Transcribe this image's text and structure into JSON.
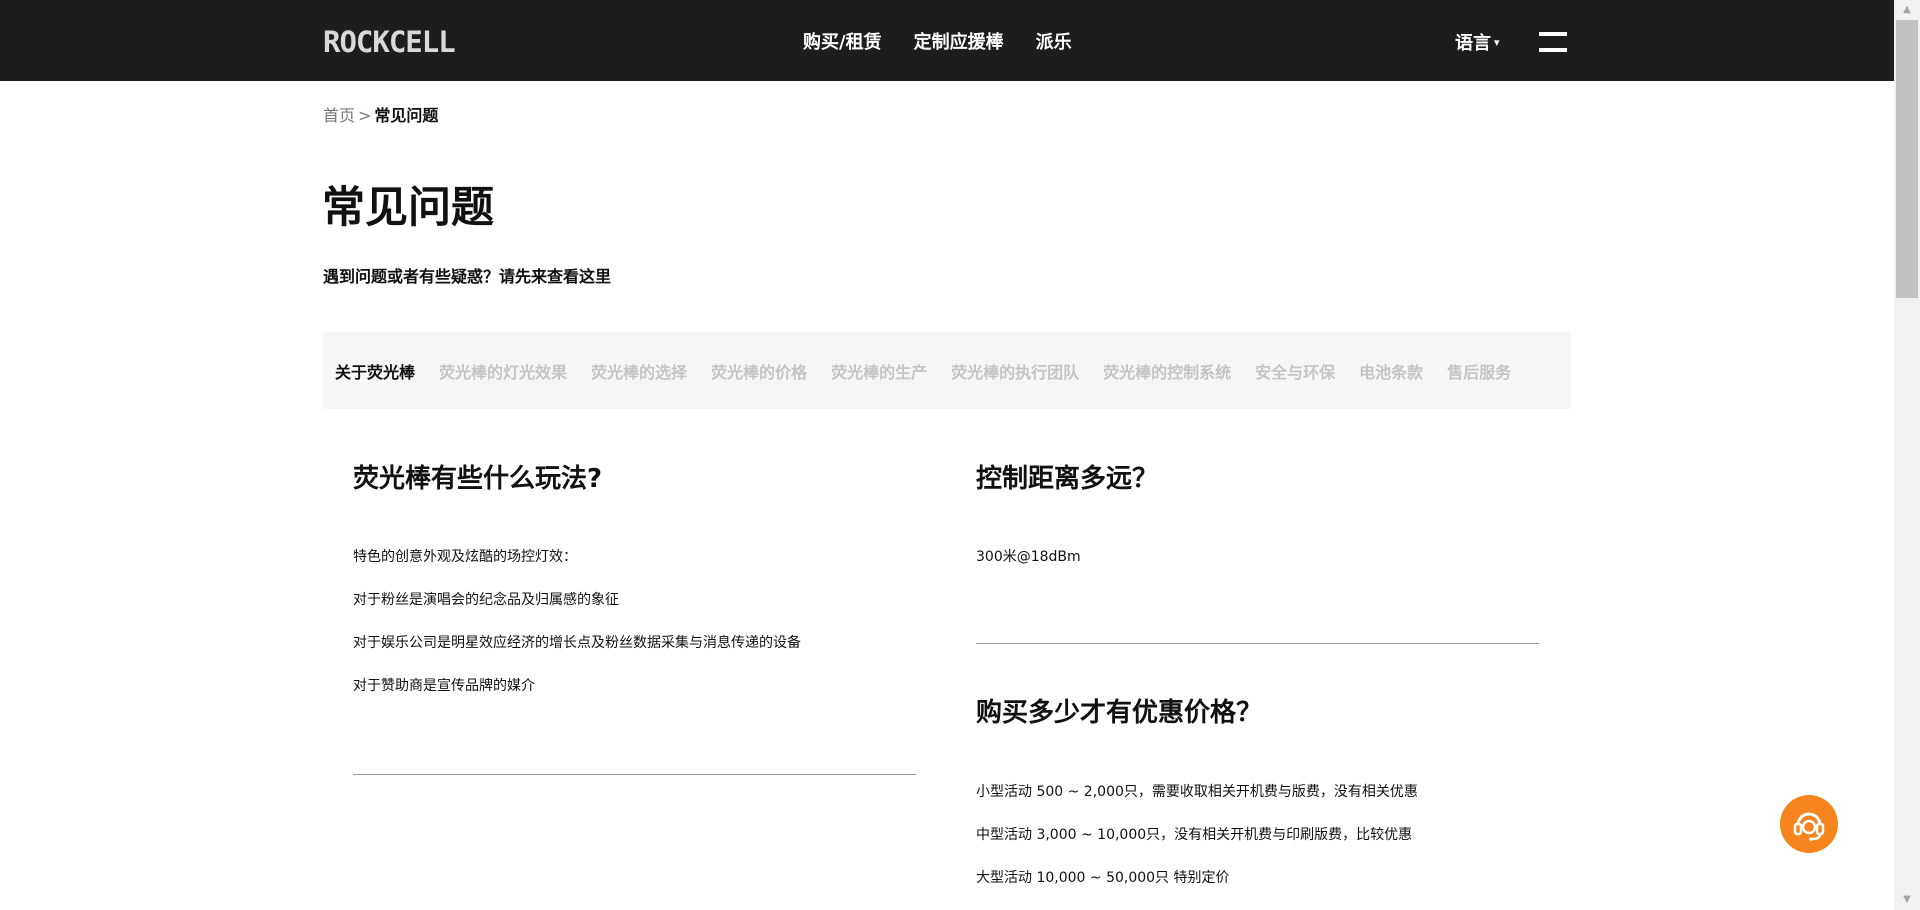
{
  "header": {
    "logo": "ROCKCELL",
    "nav": [
      "购买/租赁",
      "定制应援棒",
      "派乐"
    ],
    "language": "语言"
  },
  "breadcrumb": {
    "home": "首页",
    "separator": ">",
    "current": "常见问题"
  },
  "page": {
    "title": "常见问题",
    "subtitle": "遇到问题或者有些疑惑？请先来查看这里"
  },
  "tabs": [
    {
      "label": "关于荧光棒",
      "active": true
    },
    {
      "label": "荧光棒的灯光效果",
      "active": false
    },
    {
      "label": "荧光棒的选择",
      "active": false
    },
    {
      "label": "荧光棒的价格",
      "active": false
    },
    {
      "label": "荧光棒的生产",
      "active": false
    },
    {
      "label": "荧光棒的执行团队",
      "active": false
    },
    {
      "label": "荧光棒的控制系统",
      "active": false
    },
    {
      "label": "安全与环保",
      "active": false
    },
    {
      "label": "电池条款",
      "active": false
    },
    {
      "label": "售后服务",
      "active": false
    }
  ],
  "faq": {
    "q1": {
      "title": "荧光棒有些什么玩法?",
      "lines": [
        "特色的创意外观及炫酷的场控灯效：",
        "对于粉丝是演唱会的纪念品及归属感的象征",
        "对于娱乐公司是明星效应经济的增长点及粉丝数据采集与消息传递的设备",
        "对于赞助商是宣传品牌的媒介"
      ]
    },
    "q2": {
      "title": "控制距离多远？",
      "lines": [
        "300米@18dBm"
      ]
    },
    "q3": {
      "title": "购买多少才有优惠价格？",
      "lines": [
        "小型活动 500 ~ 2,000只，需要收取相关开机费与版费，没有相关优惠",
        "中型活动 3,000 ~ 10,000只，没有相关开机费与印刷版费，比较优惠",
        "大型活动 10,000 ~ 50,000只 特别定价"
      ]
    }
  },
  "colors": {
    "header_bg": "#1d1d1d",
    "tab_bg": "#f6f6f6",
    "tab_inactive": "#c4c4c4",
    "service_button": "#f7851e"
  }
}
